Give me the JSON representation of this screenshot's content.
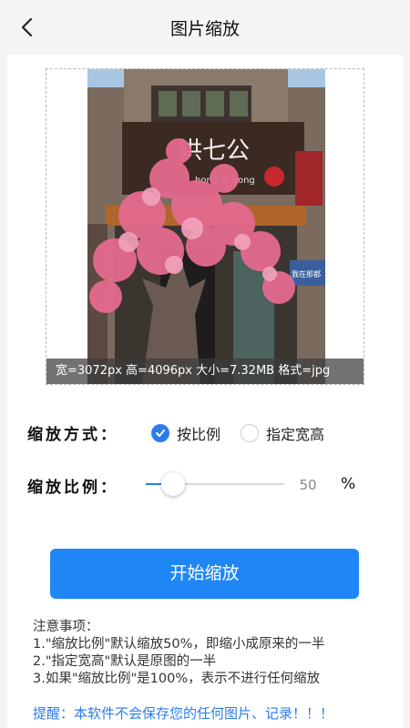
{
  "header": {
    "title": "图片缩放"
  },
  "image": {
    "info": "宽=3072px 高=4096px 大小=7.32MB 格式=jpg",
    "sign_texts": [
      "洪七公",
      "hong qi gong",
      "我在那都"
    ]
  },
  "mode": {
    "label": "缩放方式：",
    "options": [
      {
        "label": "按比例",
        "selected": true
      },
      {
        "label": "指定宽高",
        "selected": false
      }
    ]
  },
  "scale": {
    "label": "缩放比例：",
    "value": "50",
    "fraction": 0.2,
    "unit": "%"
  },
  "action": {
    "start_label": "开始缩放"
  },
  "notes": {
    "title": "注意事项：",
    "items": [
      "1.\"缩放比例\"默认缩放50%，即缩小成原来的一半",
      "2.\"指定宽高\"默认是原图的一半",
      "3.如果\"缩放比例\"是100%，表示不进行任何缩放"
    ]
  },
  "reminder": "提醒：本软件不会保存您的任何图片、记录！！！",
  "colors": {
    "accent": "#2b7de9",
    "button": "#1f87f5"
  }
}
